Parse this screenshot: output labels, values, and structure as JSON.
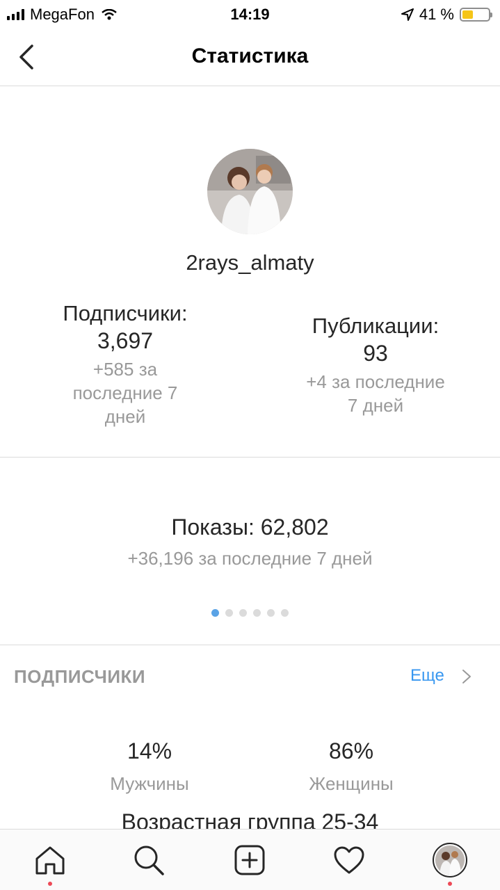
{
  "status_bar": {
    "carrier": "MegaFon",
    "time": "14:19",
    "battery": "41 %",
    "battery_level": 0.41,
    "icons": [
      "signal-icon",
      "wifi-icon",
      "location-arrow-icon",
      "battery-icon"
    ]
  },
  "nav": {
    "title": "Статистика",
    "back_icon": "chevron-left-icon"
  },
  "profile": {
    "username": "2rays_almaty"
  },
  "followers": {
    "label": "Подписчики:",
    "value": "3,697",
    "change_line1": "+585 за",
    "change_line2": "последние 7",
    "change_line3": "дней"
  },
  "posts": {
    "label": "Публикации:",
    "value": "93",
    "change_line1": "+4 за последние",
    "change_line2": "7 дней"
  },
  "impressions": {
    "line1": "Показы: 62,802",
    "line2": "+36,196 за последние 7 дней"
  },
  "pager": {
    "count": 6,
    "active_index": 0
  },
  "audience": {
    "section_title": "ПОДПИСЧИКИ",
    "more_label": "Еще",
    "men_pct": "14%",
    "men_label": "Мужчины",
    "women_pct": "86%",
    "women_label": "Женщины",
    "age_group": "Возрастная группа 25-34"
  },
  "tab_bar": {
    "tabs": [
      "home-icon",
      "search-icon",
      "new-post-icon",
      "activity-heart-icon",
      "profile-avatar"
    ]
  },
  "colors": {
    "accent_blue": "#3897f0",
    "notification_red": "#ed4956",
    "battery_yellow": "#f5c518",
    "muted_text": "#999999"
  }
}
